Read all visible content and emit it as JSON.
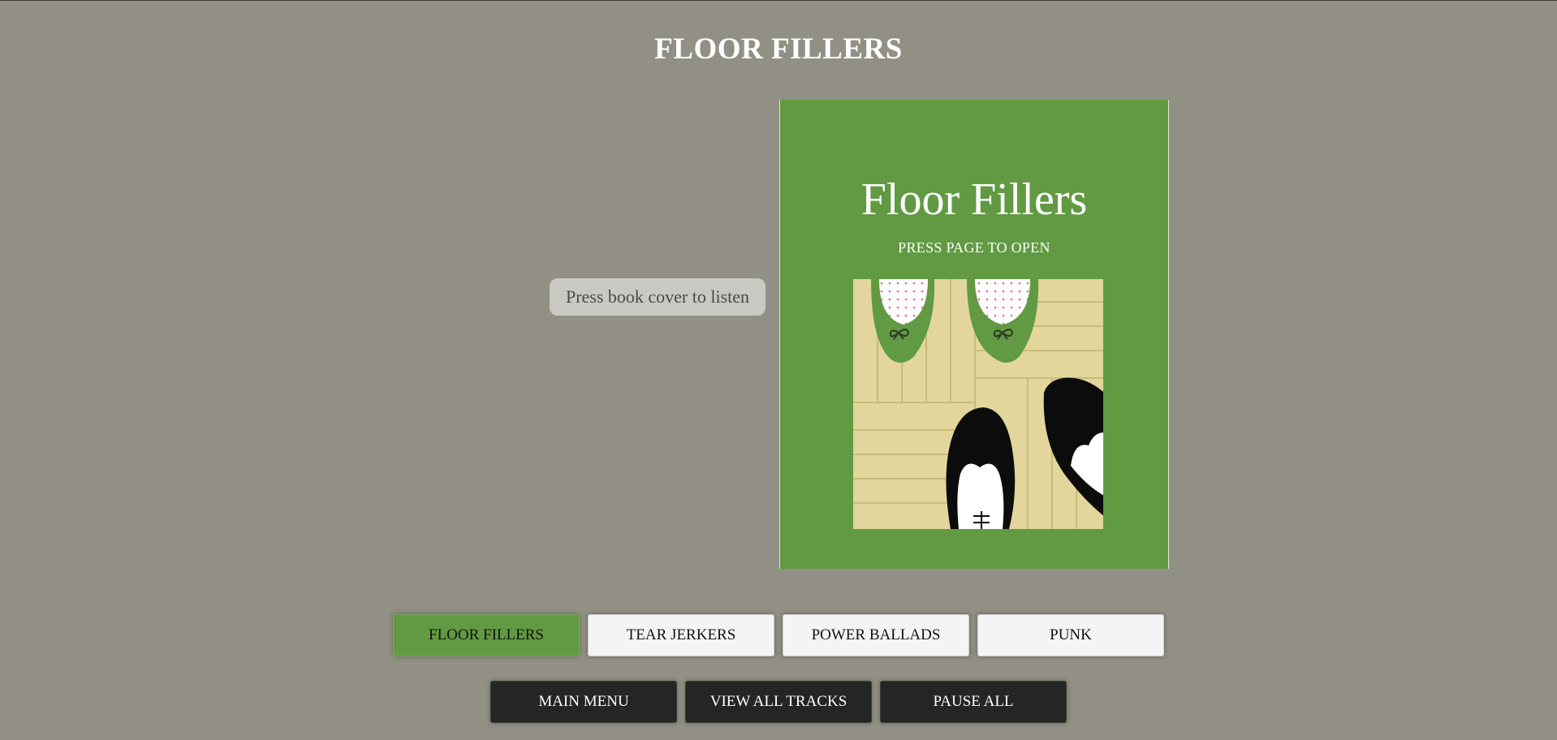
{
  "page": {
    "title": "FLOOR FILLERS"
  },
  "hint": {
    "text": "Press book cover to listen"
  },
  "book": {
    "title": "Floor Fillers",
    "subtitle": "PRESS PAGE TO OPEN"
  },
  "categories": [
    {
      "label": "FLOOR FILLERS",
      "active": true
    },
    {
      "label": "TEAR JERKERS",
      "active": false
    },
    {
      "label": "POWER BALLADS",
      "active": false
    },
    {
      "label": "PUNK",
      "active": false
    }
  ],
  "nav": {
    "main_menu": "MAIN MENU",
    "view_all": "VIEW ALL TRACKS",
    "pause_all": "PAUSE ALL"
  },
  "colors": {
    "background": "#929084",
    "accent_green": "#619a42",
    "dark_button": "#232623",
    "floor": "#e2d69c"
  }
}
